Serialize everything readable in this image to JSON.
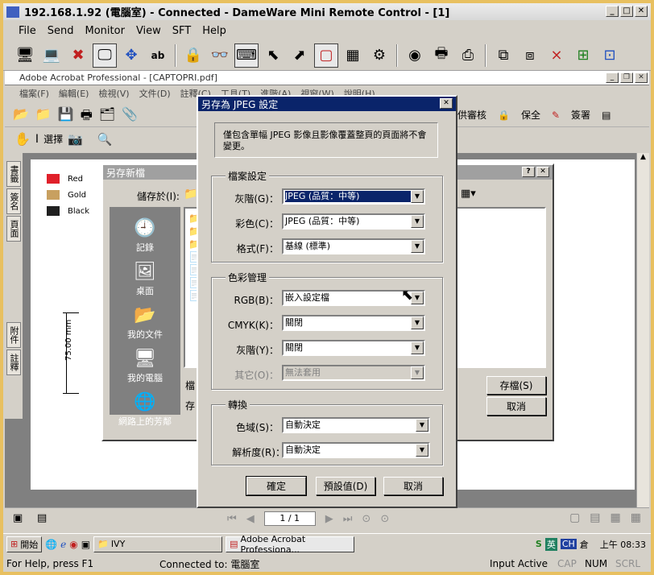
{
  "window": {
    "title": "192.168.1.92 (電腦室) - Connected - DameWare Mini Remote Control - [1]"
  },
  "menu": [
    "File",
    "Send",
    "Monitor",
    "View",
    "SFT",
    "Help"
  ],
  "toolbar_icons": [
    "computer-icon",
    "computer-arrow-icon",
    "disconnect-icon",
    "monitor-icon",
    "move-icon",
    "font-icon",
    "lock-icon",
    "glasses-icon",
    "keyboard-icon",
    "cursor-icon",
    "cursor-b-icon",
    "frame-icon",
    "grid-icon",
    "settings-icon",
    "disc-icon",
    "printer-icon",
    "printer2-icon",
    "network-icon",
    "network2-icon",
    "network-x-icon",
    "network-add-icon",
    "network-share-icon"
  ],
  "acrobat": {
    "title": "Adobe Acrobat Professional - [CAPTOPRI.pdf]",
    "menu": [
      "檔案(F)",
      "編輯(E)",
      "檢視(V)",
      "文件(D)",
      "註釋(C)",
      "工具(T)",
      "進階(A)",
      "視窗(W)",
      "說明(H)"
    ],
    "tb_items": [
      "供審核",
      "保全",
      "簽署"
    ],
    "tb2_select": "選擇",
    "side_tabs": [
      "書籤",
      "簽名",
      "頁面",
      "附件",
      "註釋"
    ],
    "legend": [
      {
        "label": "Red",
        "color": "#e0202a"
      },
      {
        "label": "Gold",
        "color": "#c8a060"
      },
      {
        "label": "Black",
        "color": "#202020"
      }
    ],
    "dimension_label": "75.00 mm",
    "page_indicator": "1 / 1"
  },
  "saveas": {
    "title": "另存新檔",
    "save_in_label": "儲存於(I):",
    "places": [
      "記錄",
      "桌面",
      "我的文件",
      "我的電腦",
      "網路上的芳鄰"
    ],
    "filename_label": "檔",
    "filetype_label": "存",
    "save_button": "存檔(S)",
    "cancel_button": "取消"
  },
  "jpeg": {
    "title": "另存為 JPEG 設定",
    "notice": "僅包含單幅 JPEG 影像且影像覆蓋整頁的頁面將不會變更。",
    "file_settings": {
      "label": "檔案設定",
      "gray_label": "灰階(G)：",
      "gray_value": "JPEG (品質：中等)",
      "color_label": "彩色(C)：",
      "color_value": "JPEG (品質：中等)",
      "format_label": "格式(F)：",
      "format_value": "基線 (標準)"
    },
    "color_mgmt": {
      "label": "色彩管理",
      "rgb_label": "RGB(B)：",
      "rgb_value": "嵌入設定檔",
      "cmyk_label": "CMYK(K)：",
      "cmyk_value": "關閉",
      "gray_label": "灰階(Y)：",
      "gray_value": "關閉",
      "other_label": "其它(O)：",
      "other_value": "無法套用"
    },
    "convert": {
      "label": "轉換",
      "gamut_label": "色域(S)：",
      "gamut_value": "自動決定",
      "res_label": "解析度(R)：",
      "res_value": "自動決定"
    },
    "ok": "確定",
    "defaults": "預設值(D)",
    "cancel": "取消"
  },
  "taskbar": {
    "start": "開始",
    "items": [
      "IVY",
      "Adobe Acrobat Professiona..."
    ],
    "tray_icons": [
      "S",
      "英",
      "CH",
      "倉"
    ],
    "clock": "上午 08:33"
  },
  "statusbar": {
    "help": "For Help, press F1",
    "connected": "Connected to: 電腦室",
    "input": "Input Active",
    "cap": "CAP",
    "num": "NUM",
    "scrl": "SCRL"
  }
}
